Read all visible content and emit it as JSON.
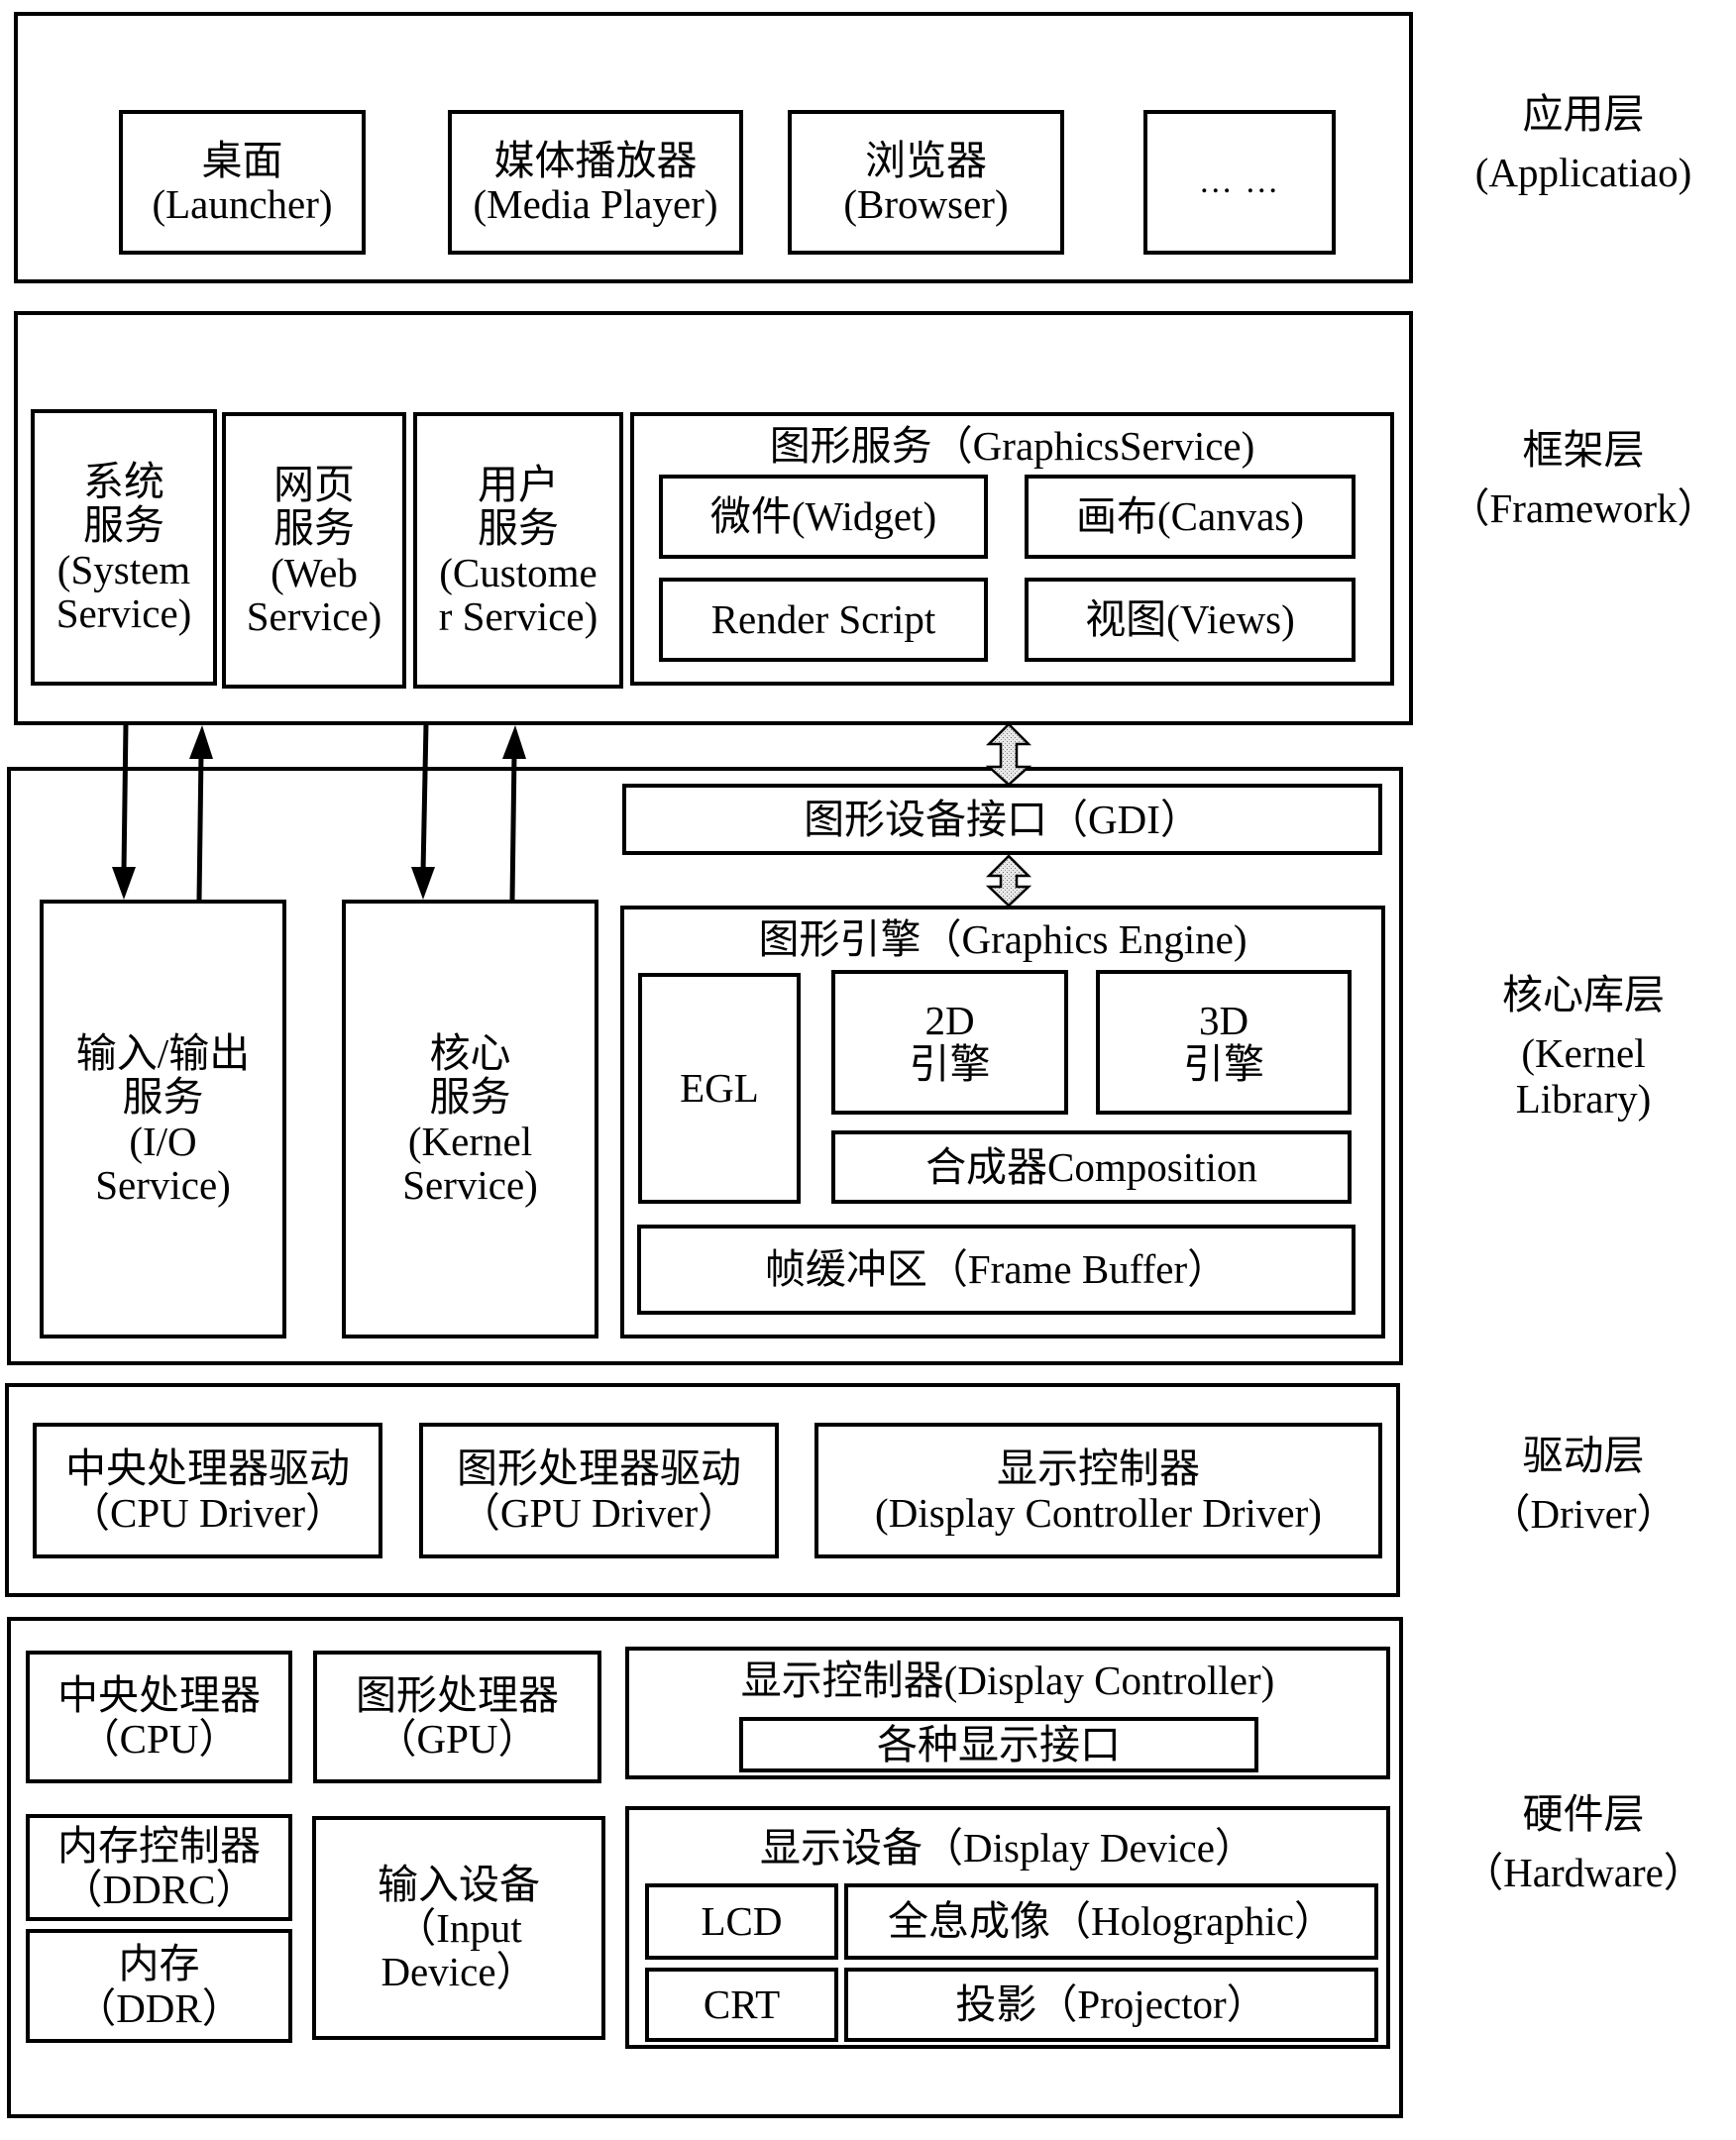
{
  "layers": {
    "application": {
      "label_cn": "应用层",
      "label_en": "(Applicatiao)",
      "apps": [
        {
          "cn": "桌面",
          "en": "(Launcher)"
        },
        {
          "cn": "媒体播放器",
          "en": "(Media Player)"
        },
        {
          "cn": "浏览器",
          "en": "(Browser)"
        },
        {
          "text": "… …"
        }
      ]
    },
    "framework": {
      "label_cn": "框架层",
      "label_en": "（Framework）",
      "services": [
        {
          "l1": "系统",
          "l2": "服务",
          "l3": "(System",
          "l4": "Service)"
        },
        {
          "l1": "网页",
          "l2": "服务",
          "l3": "(Web",
          "l4": "Service)"
        },
        {
          "l1": "用户",
          "l2": "服务",
          "l3": "(Custome",
          "l4": "r Service)"
        }
      ],
      "graphics_service": {
        "title": "图形服务（GraphicsService)",
        "items": [
          "微件(Widget)",
          "画布(Canvas)",
          "Render Script",
          "视图(Views)"
        ]
      }
    },
    "kernel": {
      "label_cn": "核心库层",
      "label_en1": "(Kernel",
      "label_en2": "Library)",
      "gdi": "图形设备接口（GDI）",
      "io_service": {
        "l1": "输入/输出",
        "l2": "服务",
        "l3": "(I/O",
        "l4": "Service)"
      },
      "kernel_service": {
        "l1": "核心",
        "l2": "服务",
        "l3": "(Kernel",
        "l4": "Service)"
      },
      "graphics_engine": {
        "title": "图形引擎（Graphics Engine)",
        "egl": "EGL",
        "engine_2d": {
          "l1": "2D",
          "l2": "引擎"
        },
        "engine_3d": {
          "l1": "3D",
          "l2": "引擎"
        },
        "composition": "合成器Composition",
        "frame_buffer": "帧缓冲区（Frame Buffer）"
      }
    },
    "driver": {
      "label_cn": "驱动层",
      "label_en": "（Driver）",
      "drivers": [
        {
          "cn": "中央处理器驱动",
          "en": "（CPU Driver）"
        },
        {
          "cn": "图形处理器驱动",
          "en": "（GPU Driver）"
        },
        {
          "cn": "显示控制器",
          "en": "(Display Controller Driver)"
        }
      ]
    },
    "hardware": {
      "label_cn": "硬件层",
      "label_en": "（Hardware）",
      "cpu": {
        "cn": "中央处理器",
        "en": "（CPU）"
      },
      "gpu": {
        "cn": "图形处理器",
        "en": "（GPU）"
      },
      "display_controller": {
        "title": "显示控制器(Display Controller)",
        "ports": "各种显示接口"
      },
      "ddrc": {
        "cn": "内存控制器",
        "en": "（DDRC）"
      },
      "ddr": {
        "cn": "内存",
        "en": "（DDR）"
      },
      "input_device": {
        "l1": "输入设备",
        "l2": "（Input",
        "l3": "Device）"
      },
      "display_device": {
        "title": "显示设备（Display Device）",
        "items": [
          "LCD",
          "全息成像（Holographic）",
          "CRT",
          "投影（Projector）"
        ]
      }
    }
  }
}
